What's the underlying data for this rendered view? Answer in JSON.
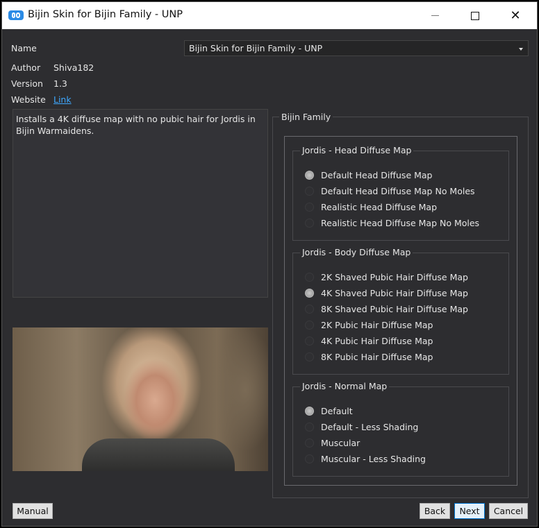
{
  "window": {
    "title": "Bijin Skin for Bijin Family - UNP"
  },
  "info": {
    "name_label": "Name",
    "author_label": "Author",
    "author": "Shiva182",
    "version_label": "Version",
    "version": "1.3",
    "website_label": "Website",
    "website_link": "Link"
  },
  "name_select": {
    "selected": "Bijin Skin for Bijin Family - UNP"
  },
  "description": "Installs a 4K diffuse map with no pubic hair for Jordis in Bijin Warmaidens.",
  "options": {
    "title": "Bijin Family",
    "groups": [
      {
        "title": "Jordis - Head Diffuse Map",
        "items": [
          {
            "label": "Default Head Diffuse Map",
            "checked": true
          },
          {
            "label": "Default Head Diffuse Map No Moles",
            "checked": false
          },
          {
            "label": "Realistic Head Diffuse Map",
            "checked": false
          },
          {
            "label": "Realistic Head Diffuse Map No Moles",
            "checked": false
          }
        ]
      },
      {
        "title": "Jordis - Body Diffuse Map",
        "items": [
          {
            "label": "2K Shaved Pubic Hair Diffuse Map",
            "checked": false
          },
          {
            "label": "4K Shaved Pubic Hair Diffuse Map",
            "checked": true
          },
          {
            "label": "8K Shaved Pubic Hair Diffuse Map",
            "checked": false
          },
          {
            "label": "2K Pubic Hair Diffuse Map",
            "checked": false
          },
          {
            "label": "4K Pubic Hair Diffuse Map",
            "checked": false
          },
          {
            "label": "8K Pubic Hair Diffuse Map",
            "checked": false
          }
        ]
      },
      {
        "title": "Jordis - Normal Map",
        "items": [
          {
            "label": "Default",
            "checked": true
          },
          {
            "label": "Default - Less Shading",
            "checked": false
          },
          {
            "label": "Muscular",
            "checked": false
          },
          {
            "label": "Muscular - Less Shading",
            "checked": false
          }
        ]
      }
    ]
  },
  "buttons": {
    "manual": "Manual",
    "back": "Back",
    "next": "Next",
    "cancel": "Cancel"
  }
}
